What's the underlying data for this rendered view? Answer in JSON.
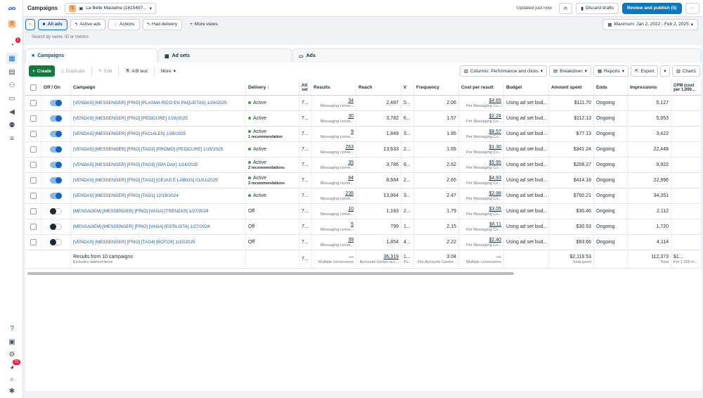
{
  "app": {
    "title": "Campaigns",
    "account_badge": "S",
    "account_name": "La Belle Maciame (1615497...",
    "updated": "Updated just now",
    "discard": "Discard drafts",
    "publish": "Review and publish (5)",
    "more": "···",
    "rail_top_badge": "S",
    "notif_count": "1",
    "alerts_count": "31"
  },
  "filters": {
    "all_ads": "All ads",
    "active_ads": "Active ads",
    "actions": "Actions",
    "had_delivery": "Had delivery",
    "more_views": "More views",
    "date": "Maximum: Jan 2, 2022 - Feb 2, 2025",
    "search_placeholder": "Search by name, ID or metrics"
  },
  "tabs": {
    "campaigns": "Campaigns",
    "adsets": "Ad sets",
    "ads": "Ads"
  },
  "toolbar": {
    "create": "Create",
    "duplicate": "Duplicate",
    "edit": "Edit",
    "ab": "A/B test",
    "more": "More",
    "columns": "Columns: Performance and clicks",
    "breakdown": "Breakdown",
    "reports": "Reports",
    "export": "Export",
    "charts": "Charts"
  },
  "columns": {
    "offon": "Off / On",
    "campaign": "Campaign",
    "delivery": "Delivery ↑",
    "attr": "Att set",
    "results": "Results",
    "reach": "Reach",
    "v": "V",
    "frequency": "Frequency",
    "cpr": "Cost per result",
    "budget": "Budget",
    "spent": "Amount spent",
    "ends": "Ends",
    "impr": "Impressions",
    "cpm": "CPM (cost per 1,000..."
  },
  "rows": [
    {
      "on": true,
      "name": "[VENDAS] [MESSENGER] [FRIO] [PLASMA RICO EN PAQUETAS] 1/26/2025",
      "status": "Active",
      "rec": "",
      "attr": "7...",
      "results": "34",
      "rsub": "Messaging conve...",
      "reach": "2,487",
      "v": "5...",
      "freq": "2.06",
      "cpr": "$4.65",
      "cprsub": "Per Messaging Co...",
      "budget": "Using ad set bud...",
      "spent": "$111.70",
      "ends": "Ongoing",
      "impr": "5,127"
    },
    {
      "on": true,
      "name": "[VENDAS] [MESSENGER] [FRIO] [PEDICURE] 1/26/2025",
      "status": "Active",
      "rec": "",
      "attr": "7...",
      "results": "30",
      "rsub": "Messaging conve...",
      "reach": "3,782",
      "v": "6...",
      "freq": "1.57",
      "cpr": "$2.24",
      "cprsub": "Per Messaging Co...",
      "budget": "Using ad set bud...",
      "spent": "$112.13",
      "ends": "Ongoing",
      "impr": "5,953"
    },
    {
      "on": true,
      "name": "[VENDAS] [MESSENGER] [FRIO] [FACIALES] 1/26/2025",
      "status": "Active",
      "rec": "1 recommendation",
      "attr": "7...",
      "results": "9",
      "rsub": "Messaging conve...",
      "reach": "1,849",
      "v": "3...",
      "freq": "1.85",
      "cpr": "$8.57",
      "cprsub": "Per Messaging Co...",
      "budget": "Using ad set bud...",
      "spent": "$77.13",
      "ends": "Ongoing",
      "impr": "3,422"
    },
    {
      "on": true,
      "name": "[VENDAS] [MESSENGER] [FRIO] [TAG3] [PROMO] [PEDICURE] 1/15/2025",
      "status": "Active",
      "rec": "",
      "attr": "7...",
      "results": "263",
      "rsub": "Messaging conve...",
      "reach": "13,633",
      "v": "2...",
      "freq": "1.65",
      "cpr": "$1.30",
      "cprsub": "Per Messaging Co...",
      "budget": "Using ad set bud...",
      "spent": "$341.24",
      "ends": "Ongoing",
      "impr": "22,448"
    },
    {
      "on": true,
      "name": "[VENDAS] [MESSENGER] [FRIO] [TAG3] [SPA DAY] 1/14/2025",
      "status": "Active",
      "rec": "2 recommendations",
      "attr": "7...",
      "results": "35",
      "rsub": "Messaging conve...",
      "reach": "3,786",
      "v": "9...",
      "freq": "2.62",
      "cpr": "$5.95",
      "cprsub": "Per Messaging Co...",
      "budget": "Using ad set bud...",
      "spent": "$208.27",
      "ends": "Ongoing",
      "impr": "9,922"
    },
    {
      "on": true,
      "name": "[VENDAS] [MESSENGER] [FRIO] [TAG2] [CEJAS E LABIOS] 01/01/2025",
      "status": "Active",
      "rec": "3 recommendations",
      "attr": "7...",
      "results": "84",
      "rsub": "Messaging conve...",
      "reach": "8,684",
      "v": "2...",
      "freq": "2.65",
      "cpr": "$4.93",
      "cprsub": "Per Messaging Co...",
      "budget": "Using ad set bud...",
      "spent": "$414.18",
      "ends": "Ongoing",
      "impr": "22,996"
    },
    {
      "on": true,
      "name": "[VENDAS] [MESSENGER] [FRIO] [TAG1] 12/18/2024",
      "status": "Active",
      "rec": "",
      "attr": "7...",
      "results": "235",
      "rsub": "Messaging conve...",
      "reach": "13,964",
      "v": "3...",
      "freq": "2.47",
      "cpr": "$2.98",
      "cprsub": "Per Messaging Co...",
      "budget": "Using ad set bud...",
      "spent": "$700.21",
      "ends": "Ongoing",
      "impr": "34,351"
    },
    {
      "on": false,
      "name": "[MENSAGEM] [MESSENGER] [FRIO] [VAGA] [TRENZAS] 1/27/2024",
      "status": "Off",
      "rec": "",
      "attr": "7...",
      "results": "10",
      "rsub": "Messaging conve...",
      "reach": "1,183",
      "v": "2...",
      "freq": "1.79",
      "cpr": "$3.05",
      "cprsub": "Per Messaging Co...",
      "budget": "Using ad set bud...",
      "spent": "$30.46",
      "ends": "Ongoing",
      "impr": "2,112"
    },
    {
      "on": false,
      "name": "[MENSAGEM] [MESSENGER] [FRIO] [VAGA] [ESTILISTA] 1/27/2024",
      "status": "Off",
      "rec": "",
      "attr": "7...",
      "results": "5",
      "rsub": "Messaging conve...",
      "reach": "799",
      "v": "1...",
      "freq": "2.15",
      "cpr": "$6.11",
      "cprsub": "Per Messaging Co...",
      "budget": "Using ad set bud...",
      "spent": "$30.53",
      "ends": "Ongoing",
      "impr": "1,720"
    },
    {
      "on": false,
      "name": "[VENDAS] [MESSENGER] [FRIO] [TAG4] [BOTOX] 1/15/2025",
      "status": "Off",
      "rec": "",
      "attr": "7...",
      "results": "39",
      "rsub": "Messaging conve...",
      "reach": "1,854",
      "v": "4...",
      "freq": "2.22",
      "cpr": "$2.40",
      "cprsub": "Per Messaging Co...",
      "budget": "Using ad set bud...",
      "spent": "$93.66",
      "ends": "Ongoing",
      "impr": "4,114"
    }
  ],
  "totals": {
    "label": "Results from 10 campaigns",
    "sub": "Excludes deleted items",
    "attr": "7...",
    "results": "—",
    "rsub": "Multiple conversions",
    "reach": "36,319",
    "reachsub": "Accounts Center acc...",
    "v": "1...",
    "vsub": "To...",
    "freq": "3.04",
    "freqsub": "Per Accounts Center...",
    "cpr": "—",
    "cprsub": "Multiple conversions",
    "spent": "$2,119.53",
    "spentsub": "Total spent",
    "impr": "112,373",
    "imprsub": "Total",
    "cpm": "$1...",
    "cpmsub": "Per 1,000 in..."
  }
}
